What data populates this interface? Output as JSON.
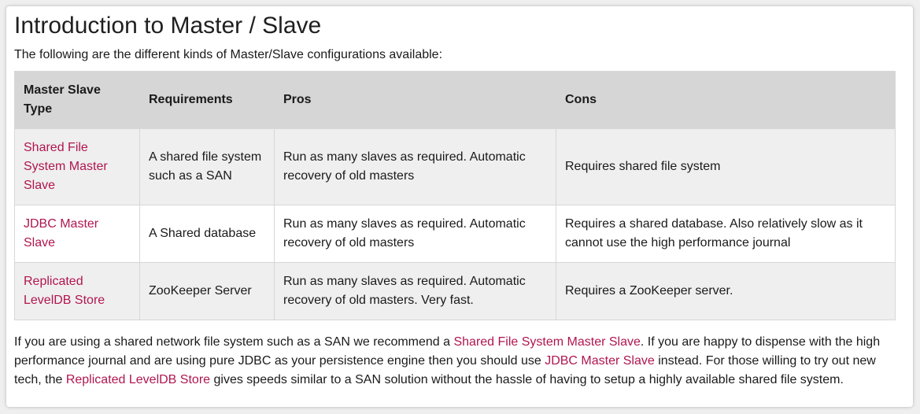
{
  "page": {
    "title": "Introduction to Master / Slave",
    "intro": "The following are the different kinds of Master/Slave configurations available:"
  },
  "table": {
    "headers": [
      "Master Slave Type",
      "Requirements",
      "Pros",
      "Cons"
    ],
    "rows": [
      {
        "type": "Shared File System Master Slave",
        "requirements": "A shared file system such as a SAN",
        "pros": "Run as many slaves as required. Automatic recovery of old masters",
        "cons": "Requires shared file system"
      },
      {
        "type": "JDBC Master Slave",
        "requirements": "A Shared database",
        "pros": "Run as many slaves as required. Automatic recovery of old masters",
        "cons": "Requires a shared database. Also relatively slow as it cannot use the high performance journal"
      },
      {
        "type": "Replicated LevelDB Store",
        "requirements": "ZooKeeper Server",
        "pros": "Run as many slaves as required. Automatic recovery of old masters. Very fast.",
        "cons": "Requires a ZooKeeper server."
      }
    ]
  },
  "outro": {
    "part1": "If you are using a shared network file system such as a SAN we recommend a ",
    "link1": "Shared File System Master Slave",
    "part2": ". If you are happy to dispense with the high performance journal and are using pure JDBC as your persistence engine then you should use ",
    "link2": "JDBC Master Slave",
    "part3": " instead. For those willing to try out new tech, the ",
    "link3": "Replicated LevelDB Store",
    "part4": " gives speeds similar to a SAN solution without the hassle of having to setup a highly available shared file system."
  },
  "colors": {
    "link": "#b0164f",
    "header_bg": "#d6d6d6",
    "row_alt_bg": "#efefef"
  }
}
